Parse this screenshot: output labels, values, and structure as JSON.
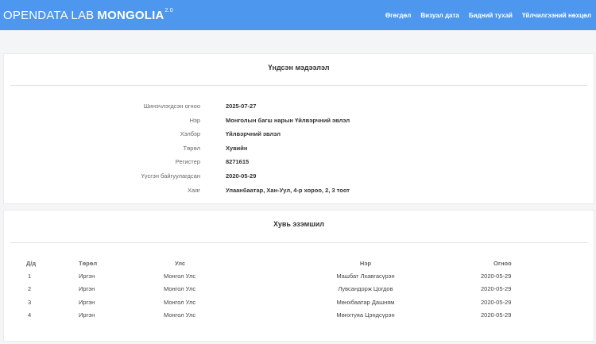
{
  "navbar": {
    "brand_light": "OPENDATA LAB",
    "brand_bold": "MONGOLIA",
    "brand_version": "2.0",
    "links": [
      "Өгөгдөл",
      "Визуал дата",
      "Бидний тухай",
      "Үйлчилгээний нөхцөл"
    ]
  },
  "basic_info": {
    "title": "Үндсэн мэдээлэл",
    "rows": [
      {
        "label": "Шинэчлэгдсэн огноо",
        "value": "2025-07-27"
      },
      {
        "label": "Нэр",
        "value": "Монголын багш нарын Үйлвэрчний эвлэл"
      },
      {
        "label": "Хэлбэр",
        "value": "Үйлвэрчний эвлэл"
      },
      {
        "label": "Төрөл",
        "value": "Хувийн"
      },
      {
        "label": "Регистер",
        "value": "8271615"
      },
      {
        "label": "Үүсгэн байгуулагдсан",
        "value": "2020-05-29"
      },
      {
        "label": "Хаяг",
        "value": "Улаанбаатар, Хан-Уул, 4-р хороо, 2, 3 тоот"
      }
    ]
  },
  "ownership": {
    "title": "Хувь эзэмшил",
    "columns": [
      "Д/д",
      "Төрөл",
      "Улс",
      "Нэр",
      "Огноо"
    ],
    "rows": [
      [
        "1",
        "Иргэн",
        "Монгол Улс",
        "Машбат Лхавгасүрэн",
        "2020-05-29"
      ],
      [
        "2",
        "Иргэн",
        "Монгол Улс",
        "Лувсандорж Цогдов",
        "2020-05-29"
      ],
      [
        "3",
        "Иргэн",
        "Монгол Улс",
        "Мөнхбаатар Дашням",
        "2020-05-29"
      ],
      [
        "4",
        "Иргэн",
        "Монгол Улс",
        "Мөнхтуяа Цэндсүрэн",
        "2020-05-29"
      ]
    ]
  }
}
